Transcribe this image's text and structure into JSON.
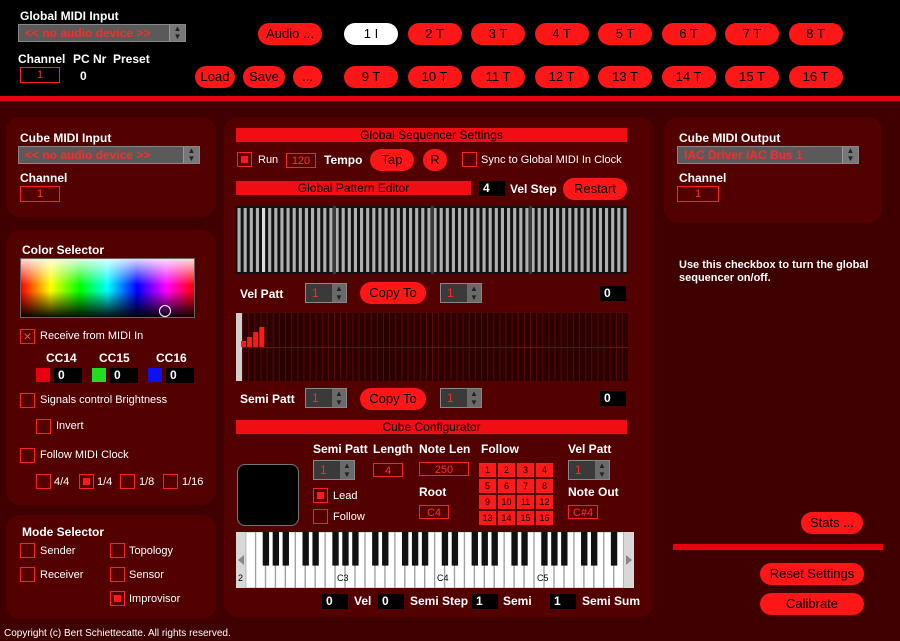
{
  "global_midi": {
    "title": "Global MIDI Input",
    "device": "<< no audio device >>",
    "channel_label": "Channel",
    "channel": "1",
    "pc_label": "PC Nr",
    "pc_value": "0",
    "preset_label": "Preset"
  },
  "top_buttons": {
    "audio": "Audio ...",
    "load": "Load",
    "save": "Save",
    "more": "..."
  },
  "presets": [
    "1 I",
    "2 T",
    "3 T",
    "4 T",
    "5 T",
    "6 T",
    "7 T",
    "8 T",
    "9 T",
    "10 T",
    "11 T",
    "12 T",
    "13 T",
    "14 T",
    "15 T",
    "16 T"
  ],
  "cube_midi_input": {
    "title": "Cube MIDI Input",
    "device": "<< no audio device >>",
    "channel_label": "Channel",
    "channel": "1"
  },
  "color_selector": {
    "title": "Color Selector",
    "receive_label": "Receive from MIDI In",
    "cc14_label": "CC14",
    "cc15_label": "CC15",
    "cc16_label": "CC16",
    "cc14": "0",
    "cc15": "0",
    "cc16": "0",
    "swatch1": "#e8000f",
    "swatch2": "#22dd22",
    "swatch3": "#1010ee",
    "signals_label": "Signals control Brightness",
    "invert_label": "Invert",
    "follow_clock_label": "Follow MIDI Clock",
    "div1": "4/4",
    "div2": "1/4",
    "div3": "1/8",
    "div4": "1/16"
  },
  "mode_selector": {
    "title": "Mode Selector",
    "sender": "Sender",
    "receiver": "Receiver",
    "topology": "Topology",
    "sensor": "Sensor",
    "improvisor": "Improvisor"
  },
  "sequencer": {
    "title": "Global Sequencer Settings",
    "run_label": "Run",
    "tempo_value": "120",
    "tempo_label": "Tempo",
    "tap": "Tap",
    "r": "R",
    "sync_label": "Sync to Global MIDI In Clock",
    "pattern_editor": "Global Pattern Editor",
    "vel_step_value": "4",
    "vel_step_label": "Vel Step",
    "restart": "Restart",
    "vel_patt_label": "Vel Patt",
    "vel_patt_a": "1",
    "copy_to": "Copy To",
    "vel_patt_b": "1",
    "vel_value": "0",
    "semi_patt_label": "Semi Patt",
    "semi_patt_a": "1",
    "semi_patt_b": "1",
    "semi_value": "0"
  },
  "configurator": {
    "title": "Cube Configurator",
    "semi_patt_label": "Semi Patt",
    "semi_patt": "1",
    "length_label": "Length",
    "length": "4",
    "note_len_label": "Note Len",
    "note_len": "250",
    "follow_label": "Follow",
    "follow_cells": [
      "1",
      "2",
      "3",
      "4",
      "5",
      "6",
      "7",
      "8",
      "9",
      "10",
      "11",
      "12",
      "13",
      "14",
      "15",
      "16"
    ],
    "vel_patt_label": "Vel Patt",
    "vel_patt": "1",
    "lead_label": "Lead",
    "follow_chk_label": "Follow",
    "root_label": "Root",
    "root": "C4",
    "note_out_label": "Note Out",
    "note_out": "C#4",
    "key_c3": "C3",
    "key_c4": "C4",
    "key_c5": "C5",
    "key_2": "2"
  },
  "bottom_readouts": {
    "vel_value": "0",
    "vel_label": "Vel",
    "semi_step_value": "0",
    "semi_step_label": "Semi Step",
    "semi_value": "1",
    "semi_label": "Semi",
    "semi_sum_value": "1",
    "semi_sum_label": "Semi Sum"
  },
  "cube_midi_output": {
    "title": "Cube MIDI Output",
    "device": "IAC Driver IAC Bus 1",
    "channel_label": "Channel",
    "channel": "1"
  },
  "help_text": "Use this checkbox to turn the global sequencer on/off.",
  "right_buttons": {
    "stats": "Stats ...",
    "reset": "Reset Settings",
    "calibrate": "Calibrate"
  },
  "footer": "Copyright (c) Bert Schiettecatte. All rights reserved."
}
